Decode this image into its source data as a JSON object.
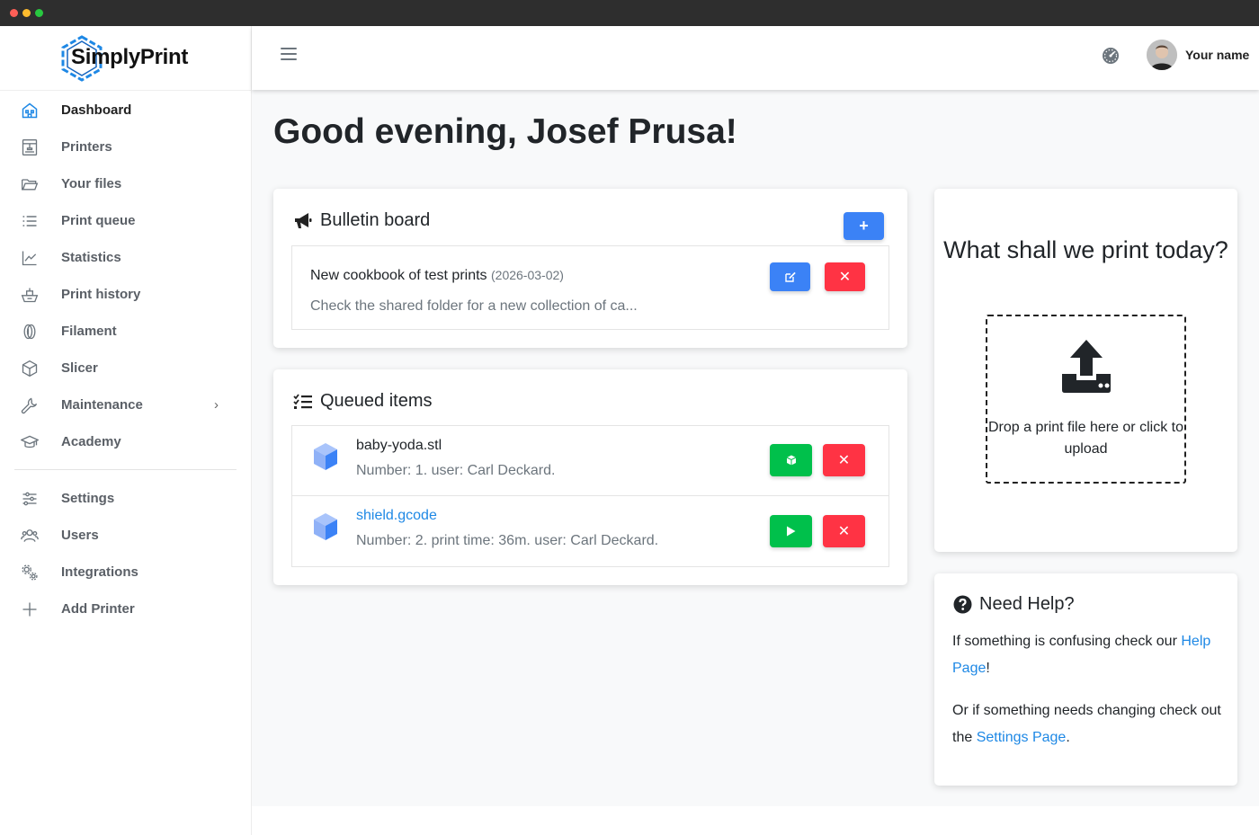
{
  "window": {
    "controls": [
      "close",
      "minimize",
      "maximize"
    ]
  },
  "brand": {
    "name": "SimplyPrint",
    "accent": "#1e88e5"
  },
  "sidebar": {
    "items": [
      {
        "label": "Dashboard",
        "icon": "dashboard-icon",
        "active": true
      },
      {
        "label": "Printers",
        "icon": "printer-icon"
      },
      {
        "label": "Your files",
        "icon": "folder-icon"
      },
      {
        "label": "Print queue",
        "icon": "list-icon"
      },
      {
        "label": "Statistics",
        "icon": "chart-icon"
      },
      {
        "label": "Print history",
        "icon": "history-icon"
      },
      {
        "label": "Filament",
        "icon": "filament-icon"
      },
      {
        "label": "Slicer",
        "icon": "cube-icon"
      },
      {
        "label": "Maintenance",
        "icon": "wrench-icon",
        "has_submenu": true
      },
      {
        "label": "Academy",
        "icon": "graduation-cap-icon"
      }
    ],
    "secondary": [
      {
        "label": "Settings",
        "icon": "sliders-icon"
      },
      {
        "label": "Users",
        "icon": "users-icon"
      },
      {
        "label": "Integrations",
        "icon": "gears-icon"
      },
      {
        "label": "Add Printer",
        "icon": "plus-icon"
      }
    ]
  },
  "header": {
    "menu_icon": "hamburger-icon",
    "gauge_icon": "gauge-icon",
    "user_name": "Your name"
  },
  "main": {
    "greeting": "Good evening, Josef Prusa!",
    "bulletin": {
      "title": "Bulletin board",
      "add_icon": "plus-icon",
      "post": {
        "title": "New cookbook of test prints",
        "date": "(2026-03-02)",
        "excerpt": "Check the shared folder for a new collection of ca..."
      }
    },
    "queue": {
      "title": "Queued items",
      "items": [
        {
          "name": "baby-yoda.stl",
          "meta": "Number: 1. user: Carl Deckard.",
          "is_link": false,
          "action_icon": "slice-cube-icon"
        },
        {
          "name": "shield.gcode",
          "meta": "Number: 2. print time: 36m. user: Carl Deckard.",
          "is_link": true,
          "action_icon": "play-icon"
        }
      ]
    },
    "upload": {
      "title": "What shall we print today?",
      "drop_text": "Drop a print file here or click to upload"
    },
    "help": {
      "title": "Need Help?",
      "p1_prefix": "If something is confusing check our ",
      "p1_link": "Help Page",
      "p1_suffix": "!",
      "p2_prefix": "Or if something needs changing check out the ",
      "p2_link": "Settings Page",
      "p2_suffix": "."
    }
  },
  "colors": {
    "blue": "#3b82f6",
    "red": "#ff3344",
    "green": "#00c04b",
    "link": "#1e88e5"
  }
}
